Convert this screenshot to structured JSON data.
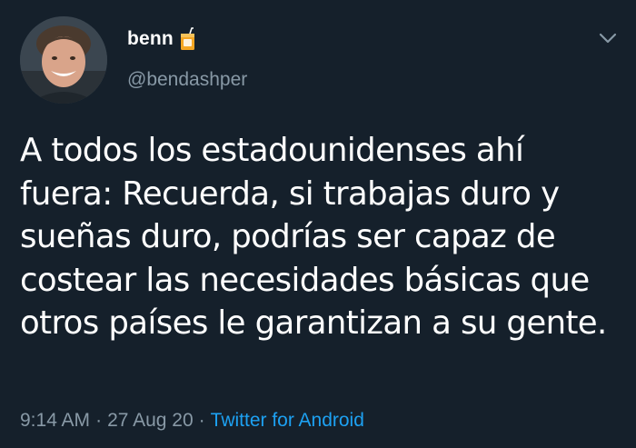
{
  "tweet": {
    "author": {
      "display_name": "benn",
      "handle": "@bendashper",
      "badge_icon": "beverage-box-icon",
      "avatar_icon": "profile-photo"
    },
    "menu_icon": "chevron-down-icon",
    "text_lines": [
      "A todos los estadounidenses ahí",
      "fuera: Recuerda, si trabajas duro y",
      "sueñas duro, podrías ser capaz de",
      "costear las necesidades básicas que",
      "otros países le garantizan a su gente."
    ],
    "time": "9:14 AM",
    "date": "27 Aug 20",
    "separator": "·",
    "source": "Twitter for Android"
  },
  "colors": {
    "background": "#15202b",
    "text": "#ffffff",
    "secondary": "#8899a6",
    "link": "#1da1f2"
  }
}
